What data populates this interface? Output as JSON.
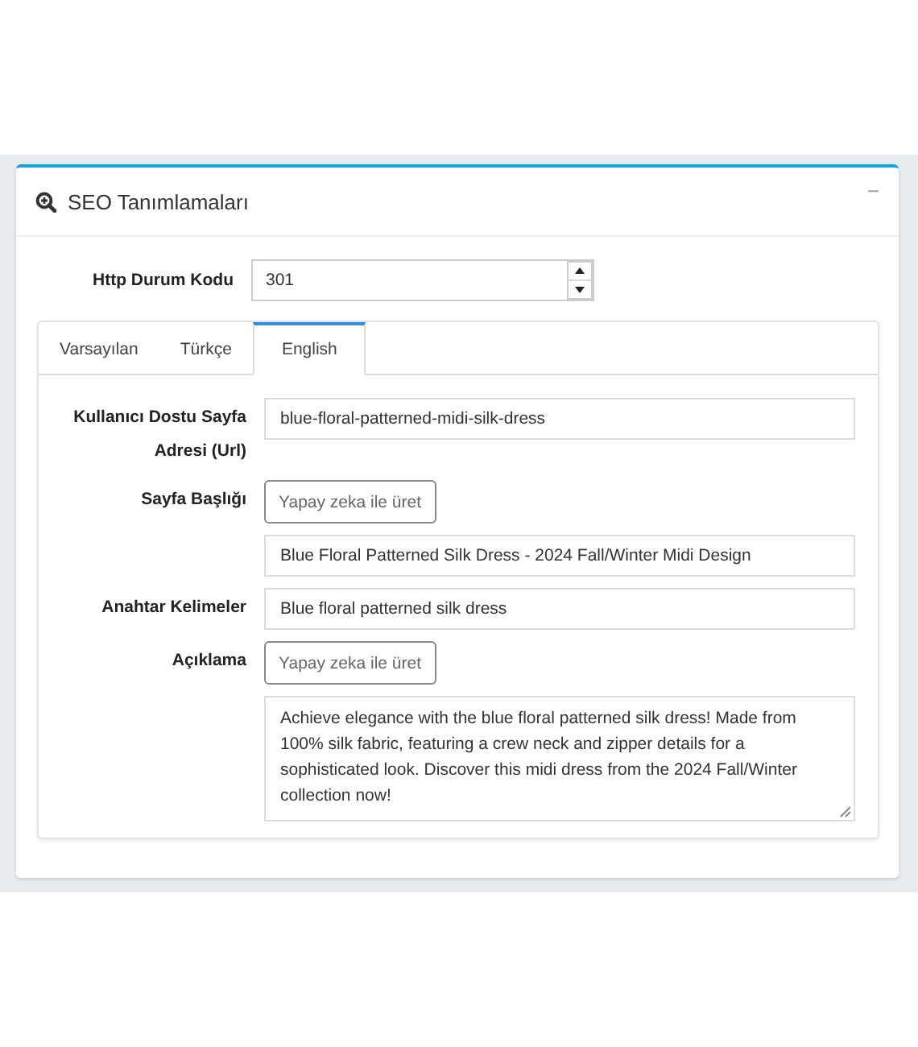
{
  "panel": {
    "title": "SEO Tanımlamaları",
    "collapse_icon": "−"
  },
  "status_code": {
    "label": "Http Durum Kodu",
    "value": "301"
  },
  "tabs": [
    {
      "label": "Varsayılan",
      "selected": false
    },
    {
      "label": "Türkçe",
      "selected": false
    },
    {
      "label": "English",
      "selected": true
    }
  ],
  "fields": [
    {
      "kind": "input",
      "label": "Kullanıcı Dostu Sayfa Adresi (Url)",
      "value": "blue-floral-patterned-midi-silk-dress"
    },
    {
      "kind": "input",
      "label": "Sayfa Başlığı",
      "ai_button": "Yapay zeka ile üret",
      "value": "Blue Floral Patterned Silk Dress - 2024 Fall/Winter Midi Design"
    },
    {
      "kind": "input",
      "label": "Anahtar Kelimeler",
      "value": "Blue floral patterned silk dress"
    },
    {
      "kind": "textarea",
      "label": "Açıklama",
      "ai_button": "Yapay zeka ile üret",
      "value": "Achieve elegance with the blue floral patterned silk dress! Made from 100% silk fabric, featuring a crew neck and zipper details for a sophisticated look. Discover this midi dress from the 2024 Fall/Winter collection now!"
    }
  ]
}
